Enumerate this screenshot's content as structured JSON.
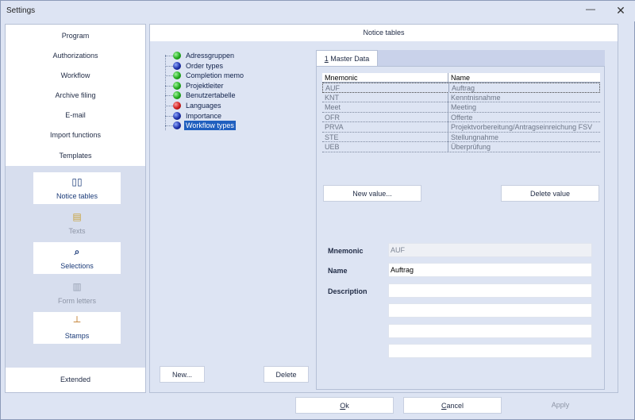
{
  "window": {
    "title": "Settings",
    "minimize_glyph": "—",
    "close_glyph": "✕"
  },
  "sidebar": {
    "nav_items": [
      {
        "label": "Program"
      },
      {
        "label": "Authorizations"
      },
      {
        "label": "Workflow"
      },
      {
        "label": "Archive filing"
      },
      {
        "label": "E-mail"
      },
      {
        "label": "Import functions"
      },
      {
        "label": "Templates"
      }
    ],
    "tiles": [
      {
        "label": "Notice tables",
        "icon": "book-icon",
        "glyph": "▯▯",
        "state": "active"
      },
      {
        "label": "Texts",
        "icon": "notepad-icon",
        "glyph": "▤",
        "state": "disabled"
      },
      {
        "label": "Selections",
        "icon": "magnifier-icon",
        "glyph": "⌕",
        "state": "active"
      },
      {
        "label": "Form letters",
        "icon": "document-icon",
        "glyph": "▥",
        "state": "disabled"
      },
      {
        "label": "Stamps",
        "icon": "stamp-icon",
        "glyph": "┴",
        "state": "active"
      }
    ],
    "extended_label": "Extended"
  },
  "main": {
    "section_title": "Notice tables",
    "tree": [
      {
        "label": "Adressgruppen",
        "color": "green"
      },
      {
        "label": "Order types",
        "color": "blue"
      },
      {
        "label": "Completion memo",
        "color": "green"
      },
      {
        "label": "Projektleiter",
        "color": "green"
      },
      {
        "label": "Benutzertabelle",
        "color": "green"
      },
      {
        "label": "Languages",
        "color": "red"
      },
      {
        "label": "Importance",
        "color": "blue"
      },
      {
        "label": "Workflow types",
        "color": "blue",
        "selected": true
      }
    ],
    "tab": {
      "number": "1",
      "label": "Master Data"
    },
    "grid": {
      "columns": [
        "Mnemonic",
        "Name"
      ],
      "rows": [
        [
          "AUF",
          "Auftrag"
        ],
        [
          "KNT",
          "Kenntnisnahme"
        ],
        [
          "Meet",
          "Meeting"
        ],
        [
          "OFR",
          "Offerte"
        ],
        [
          "PRVA",
          "Projektvorbereitung/Antragseinreichung FSV"
        ],
        [
          "STE",
          "Stellungnahme"
        ],
        [
          "UEB",
          "Überprüfung"
        ]
      ]
    },
    "new_value_label": "New value...",
    "delete_value_label": "Delete value",
    "form": {
      "mnemonic_label": "Mnemonic",
      "mnemonic_value": "AUF",
      "name_label": "Name",
      "name_value": "Auftrag",
      "description_label": "Description",
      "description_lines": [
        "",
        "",
        "",
        "",
        ""
      ]
    },
    "new_label": "New...",
    "delete_label": "Delete"
  },
  "footer": {
    "ok_underlined": "O",
    "ok_rest": "k",
    "cancel_underlined": "C",
    "cancel_rest": "ancel",
    "apply_label": "Apply"
  },
  "colors": {
    "window_bg": "#dde4f3",
    "selection": "#1f5fbf",
    "text_dark": "#1f2a44",
    "muted": "#8d95a6"
  }
}
